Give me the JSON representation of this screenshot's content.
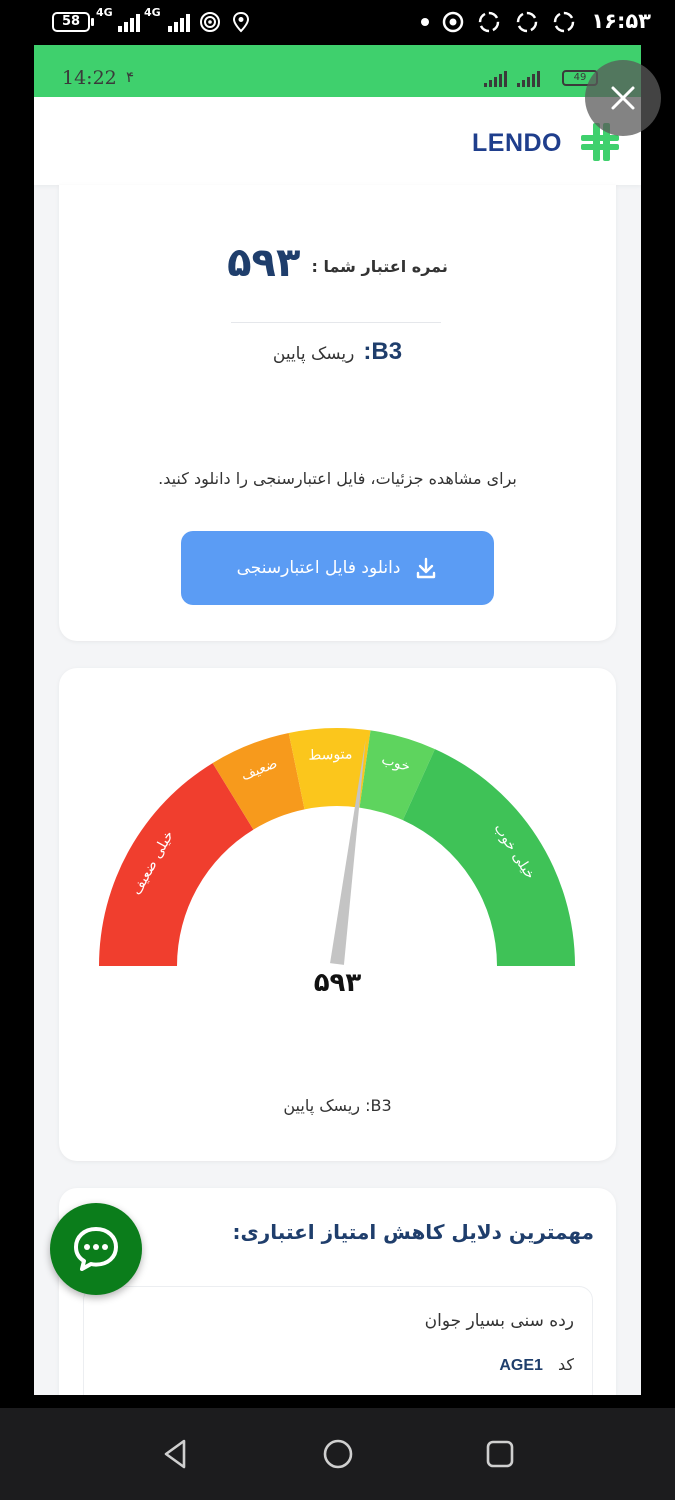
{
  "os_status": {
    "battery": "58",
    "network_1": "4G",
    "network_2": "4G",
    "time": "۱۶:۵۳"
  },
  "inner_status": {
    "time": "14:22",
    "indicator": "۴",
    "battery": "49"
  },
  "header": {
    "logo_text": "LENDO",
    "logo_color": "#3fd06d",
    "brand_color": "#1f3e8c"
  },
  "score_card": {
    "score_label": "نمره اعتبار شما :",
    "score_value": "۵۹۳",
    "risk_code": "B3:",
    "risk_text": "ریسک پایین",
    "info_text": "برای مشاهده جزئیات، فایل اعتبارسنجی را دانلود کنید.",
    "download_label": "دانلود فایل اعتبارسنجی",
    "download_icon": "download-icon",
    "button_color": "#5b9cf4"
  },
  "gauge_card": {
    "segments": [
      {
        "label": "خیلی ضعیف",
        "color": "#f03e2e"
      },
      {
        "label": "ضعیف",
        "color": "#f79a1c"
      },
      {
        "label": "متوسط",
        "color": "#fbc61c"
      },
      {
        "label": "خوب",
        "color": "#5ed45e"
      },
      {
        "label": "خیلی خوب",
        "color": "#3fc257"
      }
    ],
    "value": "۵۹۳",
    "needle_fraction": 0.54,
    "risk_text": "B3: ریسک پایین"
  },
  "reasons_card": {
    "title": "مهمترین دلایل کاهش امتیاز اعتباری:",
    "items": [
      {
        "title": "رده سنی بسیار جوان",
        "code_label": "کد",
        "code": "AGE1"
      }
    ]
  },
  "chat_fab": {
    "icon": "chat-icon",
    "color": "#0b7d1b"
  },
  "nav": {
    "back_icon": "back-icon",
    "home_icon": "home-icon",
    "recents_icon": "recents-icon"
  }
}
